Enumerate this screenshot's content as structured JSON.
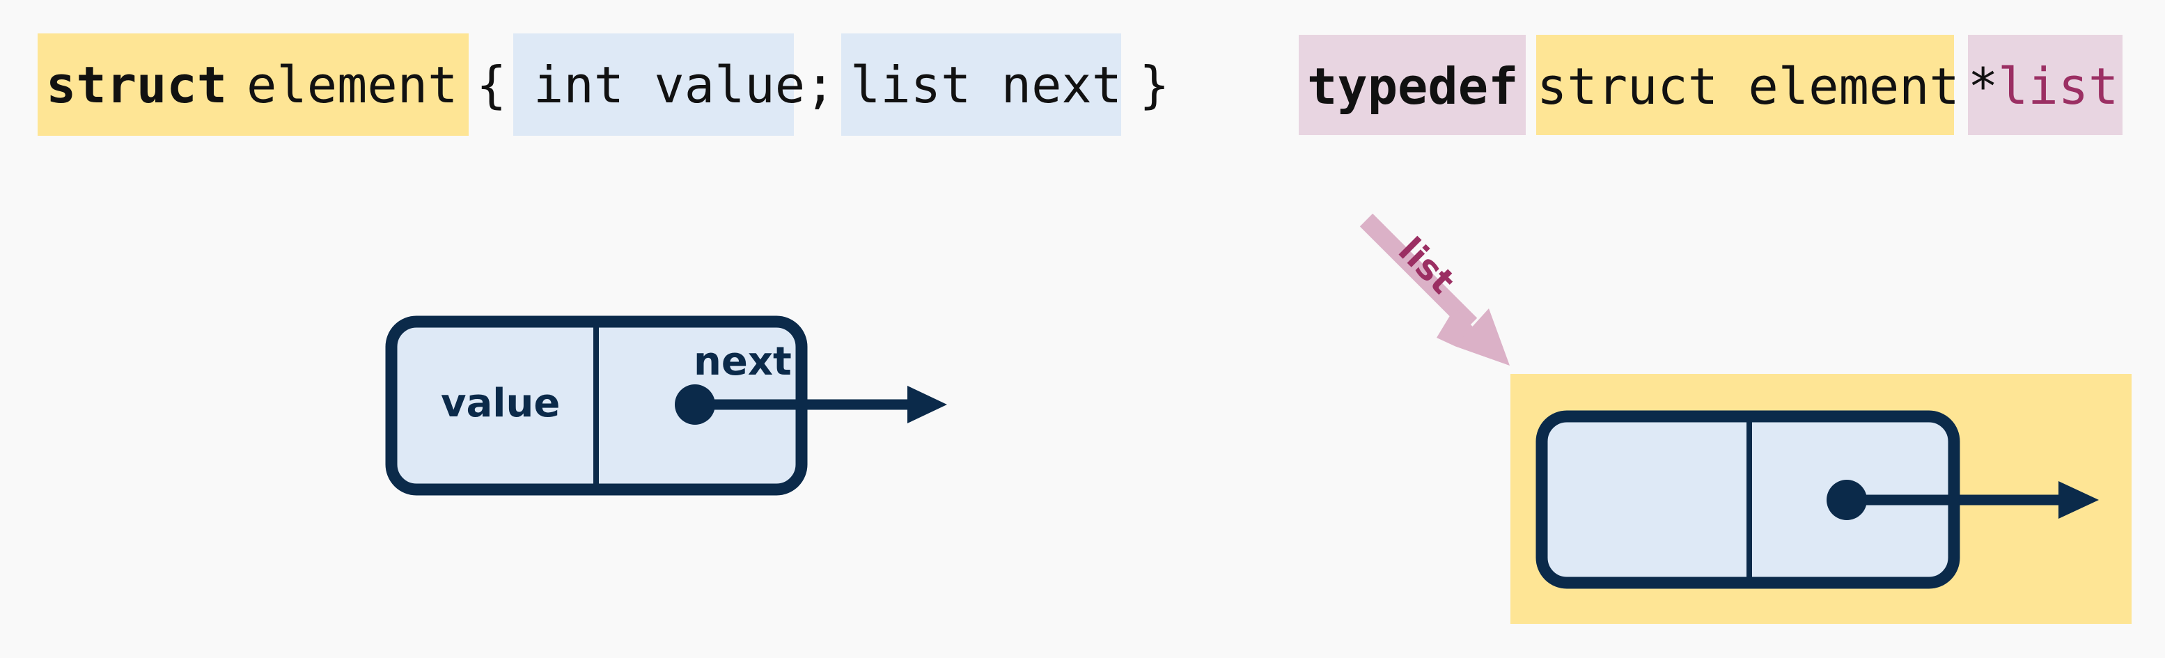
{
  "struct_line": {
    "keyword": "struct",
    "name": "element",
    "open": "{",
    "field1": "int value;",
    "field2": "list next",
    "close": "}"
  },
  "typedef_line": {
    "keyword": "typedef",
    "type": "struct element",
    "star": "*",
    "alias": "list"
  },
  "node_labels": {
    "value": "value",
    "next": "next"
  },
  "pointer_label": "list",
  "colors": {
    "background": "#f9f9f9",
    "struct_highlight": "#fee595",
    "field_highlight": "#dee9f6",
    "typedef_highlight": "#e8d5e1",
    "node_stroke": "#0b2a4a",
    "list_accent": "#9b2f63",
    "pointer_arrow": "#dbb1c7"
  }
}
